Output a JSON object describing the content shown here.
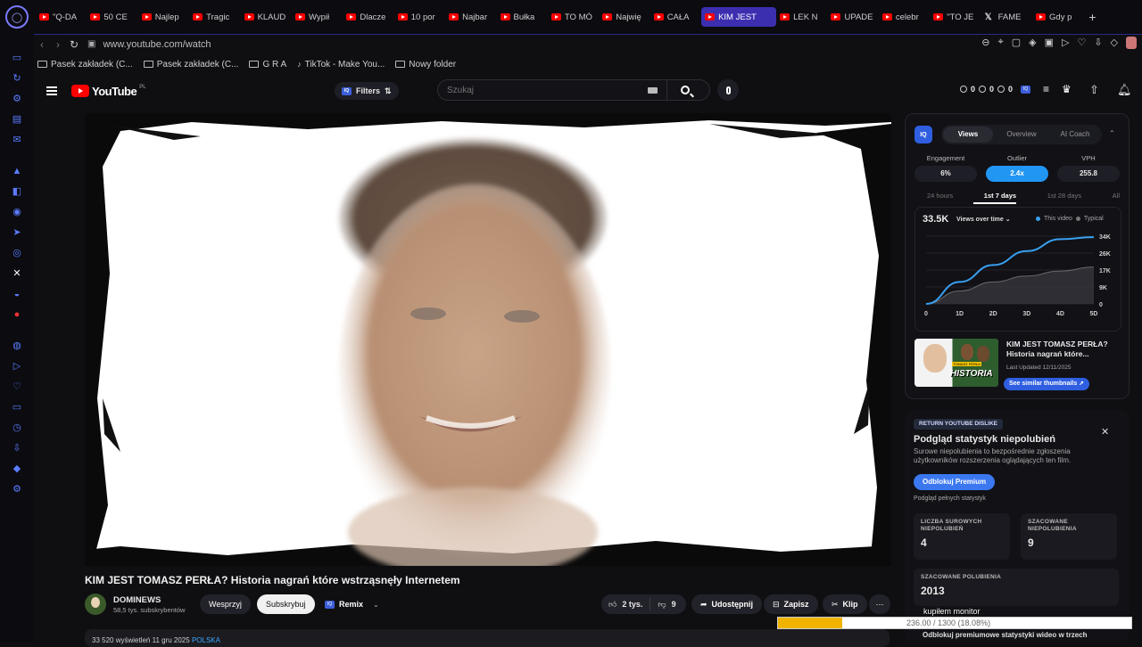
{
  "tabs": [
    {
      "label": "\"Q-DA",
      "icon": "youtube-icon"
    },
    {
      "label": "50 CE",
      "icon": "youtube-icon"
    },
    {
      "label": "Najlep",
      "icon": "youtube-icon"
    },
    {
      "label": "Tragic",
      "icon": "youtube-icon"
    },
    {
      "label": "KLAUD",
      "icon": "youtube-icon"
    },
    {
      "label": "Wypił",
      "icon": "youtube-icon"
    },
    {
      "label": "Dlacze",
      "icon": "youtube-icon"
    },
    {
      "label": "10 por",
      "icon": "youtube-icon"
    },
    {
      "label": "Najbar",
      "icon": "youtube-icon"
    },
    {
      "label": "Bułka",
      "icon": "youtube-icon"
    },
    {
      "label": "TO MÓ",
      "icon": "youtube-icon"
    },
    {
      "label": "Najwię",
      "icon": "youtube-icon"
    },
    {
      "label": "CAŁA",
      "icon": "youtube-icon"
    },
    {
      "label": "KIM JEST",
      "icon": "youtube-icon",
      "active": true
    },
    {
      "label": "LEK N",
      "icon": "youtube-icon"
    },
    {
      "label": "UPADE",
      "icon": "youtube-icon"
    },
    {
      "label": "celebr",
      "icon": "youtube-icon"
    },
    {
      "label": "\"TO JE",
      "icon": "youtube-icon"
    },
    {
      "label": "FAME",
      "icon": "x-icon"
    },
    {
      "label": "Gdy p",
      "icon": "youtube-icon"
    }
  ],
  "address": {
    "url": "www.youtube.com/watch"
  },
  "bookmarks": [
    "Pasek zakładek (C...",
    "Pasek zakładek (C...",
    "G R A",
    "TikTok - Make You...",
    "Nowy folder"
  ],
  "header": {
    "logo": "YouTube",
    "country": "PL",
    "filters": "Filters",
    "search_placeholder": "Szukaj",
    "stats": [
      "0",
      "0",
      "0"
    ]
  },
  "video": {
    "title": "KIM JEST TOMASZ PERŁA? Historia nagrań które wstrząsnęły Internetem",
    "channel": "DOMINEWS",
    "subscribers": "58,5 tys. subskrybentów",
    "support": "Wesprzyj",
    "subscribe": "Subskrybuj",
    "remix": "Remix",
    "likes": "2 tys.",
    "dislikes": "9",
    "share": "Udostępnij",
    "save": "Zapisz",
    "clip": "Klip",
    "views_line": "33 520 wyświetleń  11 gru 2025",
    "tag": "POLSKA"
  },
  "vidiq": {
    "tabs": [
      "Views",
      "Overview",
      "AI Coach"
    ],
    "metrics": [
      {
        "label": "Engagement",
        "value": "6%"
      },
      {
        "label": "Outlier",
        "value": "2.4x"
      },
      {
        "label": "VPH",
        "value": "255.8"
      }
    ],
    "ranges": [
      "24 hours",
      "1st 7 days",
      "1st 28 days",
      "All"
    ],
    "total": "33.5K",
    "selector": "Views over time",
    "legend_this": "This video",
    "legend_typical": "Typical",
    "thumb_title": "KIM JEST TOMASZ PERŁA? Historia nagrań które...",
    "thumb_updated": "Last Updated 12/11/2025",
    "thumb_button": "See similar thumbnails",
    "thumb_text": "HISTORIA",
    "thumb_tag": "TOMASZ PERŁA"
  },
  "chart_data": {
    "type": "line",
    "title": "",
    "x": [
      "0",
      "1D",
      "2D",
      "3D",
      "4D",
      "5D"
    ],
    "y_ticks": [
      "34K",
      "26K",
      "17K",
      "9K",
      "0"
    ],
    "ylim": [
      0,
      34000
    ],
    "xlabel": "",
    "ylabel": "",
    "series": [
      {
        "name": "This video",
        "color": "#39a0f0",
        "values": [
          0,
          11000,
          19500,
          26500,
          32500,
          33500
        ]
      },
      {
        "name": "Typical",
        "color": "#9a9a9a",
        "values": [
          0,
          6500,
          11000,
          14000,
          16500,
          18500
        ]
      }
    ]
  },
  "ryd": {
    "badge": "RETURN YOUTUBE DISLIKE",
    "heading": "Podgląd statystyk niepolubień",
    "para": "Surowe niepolubienia to bezpośrednie zgłoszenia użytkowników rozszerzenia oglądających ten film.",
    "button": "Odblokuj Premium",
    "sub": "Podgląd pełnych statystyk",
    "stats": [
      {
        "label": "LICZBA SUROWYCH NIEPOLUBIEŃ",
        "value": "4"
      },
      {
        "label": "SZACOWANE NIEPOLUBIENIA",
        "value": "9"
      },
      {
        "label": "SZACOWANE POLUBIENIA",
        "value": "2013"
      }
    ],
    "bottom": "Odblokuj premiumowe statystyki wideo w trzech"
  },
  "overlay": {
    "label": "kupiłem monitor",
    "text": "236.00 / 1300 (18.08%)",
    "progress": 0.1808,
    "bar_color": "#f0b400"
  }
}
